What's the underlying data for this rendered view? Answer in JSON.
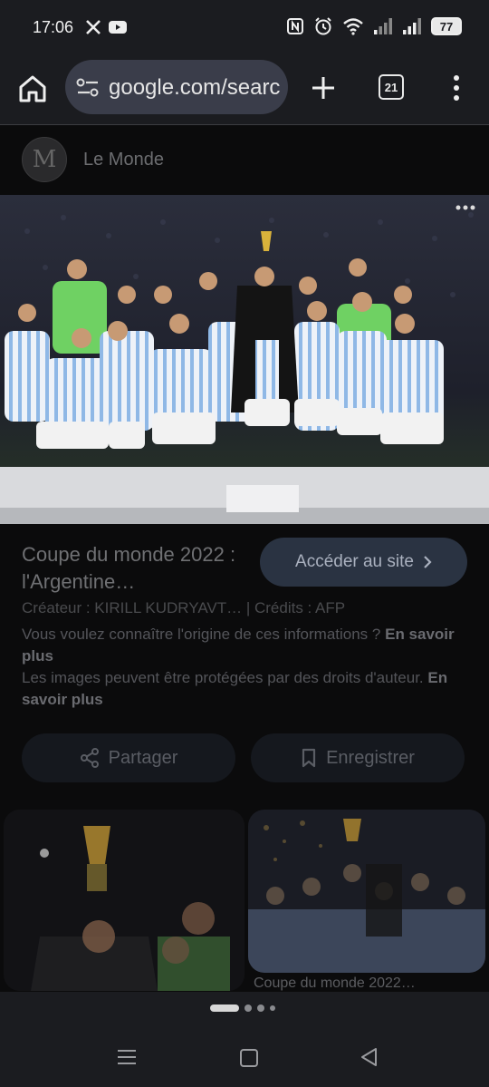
{
  "status": {
    "time": "17:06",
    "battery": "77",
    "left_icons": [
      "x-icon",
      "youtube-icon"
    ],
    "right_icons": [
      "nfc-icon",
      "alarm-icon",
      "wifi-icon",
      "signal-icon",
      "signal-icon",
      "battery-icon"
    ]
  },
  "browser": {
    "url": "google.com/search",
    "tab_count": "21"
  },
  "source": {
    "logo_letter": "M",
    "name": "Le Monde"
  },
  "result": {
    "title": "Coupe du monde 2022 : l'Argentine…",
    "visit_button": "Accéder au site",
    "credits": "Créateur : KIRILL KUDRYAVT…  | Crédits : AFP",
    "info_question": "Vous voulez connaître l'origine de ces informations ?",
    "info_link_1": "En savoir plus",
    "info_copyright": "Les images peuvent être protégées par des droits d'auteur.",
    "info_link_2": "En savoir plus",
    "share_button": "Partager",
    "save_button": "Enregistrer"
  },
  "related": {
    "right_caption": "Coupe du monde 2022…"
  },
  "colors": {
    "background": "#0b0b0c",
    "chrome": "#1b1c20",
    "visit_button_bg": "#2a3342"
  }
}
